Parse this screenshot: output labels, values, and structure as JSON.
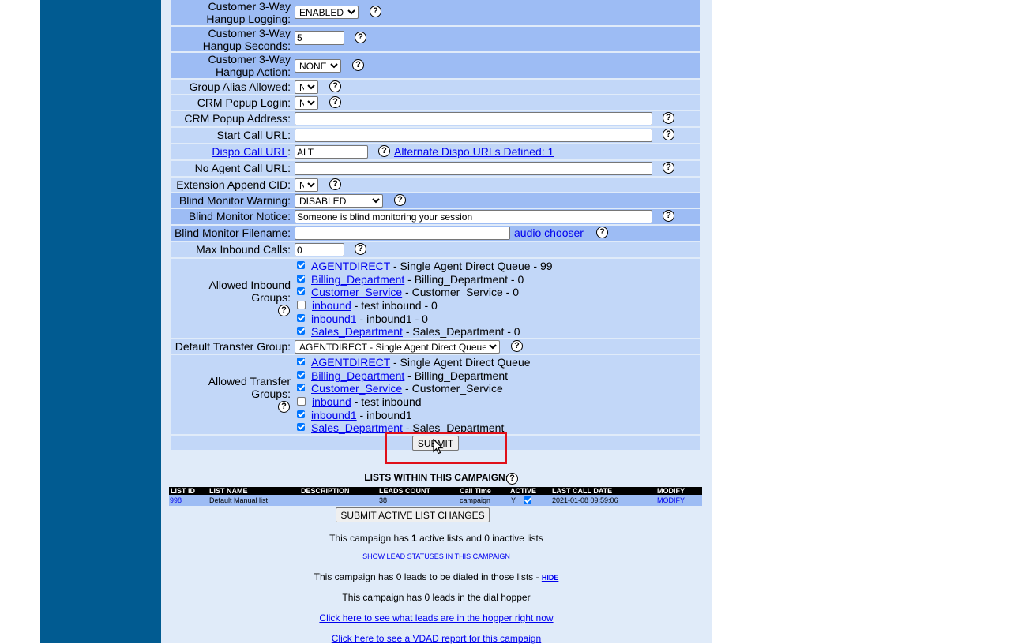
{
  "form": {
    "customer_3way_hangup_logging": {
      "label_line1": "Customer 3-Way",
      "label_line2": "Hangup Logging:",
      "value": "ENABLED"
    },
    "customer_3way_hangup_seconds": {
      "label_line1": "Customer 3-Way",
      "label_line2": "Hangup Seconds:",
      "value": "5"
    },
    "customer_3way_hangup_action": {
      "label_line1": "Customer 3-Way",
      "label_line2": "Hangup Action:",
      "value": "NONE"
    },
    "group_alias_allowed": {
      "label": "Group Alias Allowed:",
      "value": "N"
    },
    "crm_popup_login": {
      "label": "CRM Popup Login:",
      "value": "N"
    },
    "crm_popup_address": {
      "label": "CRM Popup Address:",
      "value": ""
    },
    "start_call_url": {
      "label": "Start Call URL:",
      "value": ""
    },
    "dispo_call_url": {
      "label_link": "Dispo Call URL",
      "label_suffix": ":",
      "value": "ALT",
      "alt_link": "Alternate Dispo URLs Defined: 1"
    },
    "no_agent_call_url": {
      "label": "No Agent Call URL:",
      "value": ""
    },
    "extension_append_cid": {
      "label": "Extension Append CID:",
      "value": "N"
    },
    "blind_monitor_warning": {
      "label": "Blind Monitor Warning:",
      "value": "DISABLED"
    },
    "blind_monitor_notice": {
      "label": "Blind Monitor Notice:",
      "value": "Someone is blind monitoring your session"
    },
    "blind_monitor_filename": {
      "label": "Blind Monitor Filename:",
      "value": "",
      "link": "audio chooser"
    },
    "max_inbound_calls": {
      "label": "Max Inbound Calls:",
      "value": "0"
    },
    "allowed_inbound_groups": {
      "label_line1": "Allowed Inbound",
      "label_line2": "Groups:",
      "items": [
        {
          "id": "AGENTDIRECT",
          "desc": " - Single Agent Direct Queue - 99",
          "checked": true
        },
        {
          "id": "Billing_Department",
          "desc": " - Billing_Department - 0",
          "checked": true
        },
        {
          "id": "Customer_Service",
          "desc": " - Customer_Service - 0",
          "checked": true
        },
        {
          "id": "inbound",
          "desc": " - test inbound - 0",
          "checked": false
        },
        {
          "id": "inbound1",
          "desc": " - inbound1 - 0",
          "checked": true
        },
        {
          "id": "Sales_Department",
          "desc": " - Sales_Department - 0",
          "checked": true
        }
      ]
    },
    "default_transfer_group": {
      "label": "Default Transfer Group:",
      "value": "AGENTDIRECT - Single Agent Direct Queue"
    },
    "allowed_transfer_groups": {
      "label_line1": "Allowed Transfer",
      "label_line2": "Groups:",
      "items": [
        {
          "id": "AGENTDIRECT",
          "desc": " - Single Agent Direct Queue",
          "checked": true
        },
        {
          "id": "Billing_Department",
          "desc": " - Billing_Department",
          "checked": true
        },
        {
          "id": "Customer_Service",
          "desc": " - Customer_Service",
          "checked": true
        },
        {
          "id": "inbound",
          "desc": " - test inbound",
          "checked": false
        },
        {
          "id": "inbound1",
          "desc": " - inbound1",
          "checked": true
        },
        {
          "id": "Sales_Department",
          "desc": " - Sales_Department",
          "checked": true
        }
      ]
    },
    "submit_label": "SUBMIT",
    "help_glyph": "?"
  },
  "lists": {
    "title": "LISTS WITHIN THIS CAMPAIGN:",
    "headers": [
      "LIST ID",
      "LIST NAME",
      "DESCRIPTION",
      "LEADS COUNT",
      "Call Time",
      "ACTIVE",
      "LAST CALL DATE",
      "MODIFY"
    ],
    "rows": [
      {
        "list_id": "998",
        "list_name": "Default Manual list",
        "description": "",
        "leads_count": "38",
        "call_time": "campaign",
        "active": "Y",
        "active_checked": true,
        "last_call_date": "2021-01-08 09:59:06",
        "modify": "MODIFY"
      }
    ],
    "submit_active_label": "SUBMIT ACTIVE LIST CHANGES"
  },
  "summary": {
    "active_prefix": "This campaign has ",
    "active_count": "1",
    "active_suffix": " active lists and 0 inactive lists",
    "show_statuses_link": "SHOW LEAD STATUSES IN THIS CAMPAIGN",
    "leads_to_dial": "This campaign has 0 leads to be dialed in those lists - ",
    "hide_link": "HIDE",
    "hopper_text": "This campaign has 0 leads in the dial hopper",
    "hopper_link": "Click here to see what leads are in the hopper right now",
    "vdad_link": "Click here to see a VDAD report for this campaign"
  },
  "colors": {
    "sidebar": "#015b91",
    "row_dark": "#9dbcf4",
    "row_light": "#c2d7f8",
    "highlight_box": "#e0101a"
  }
}
